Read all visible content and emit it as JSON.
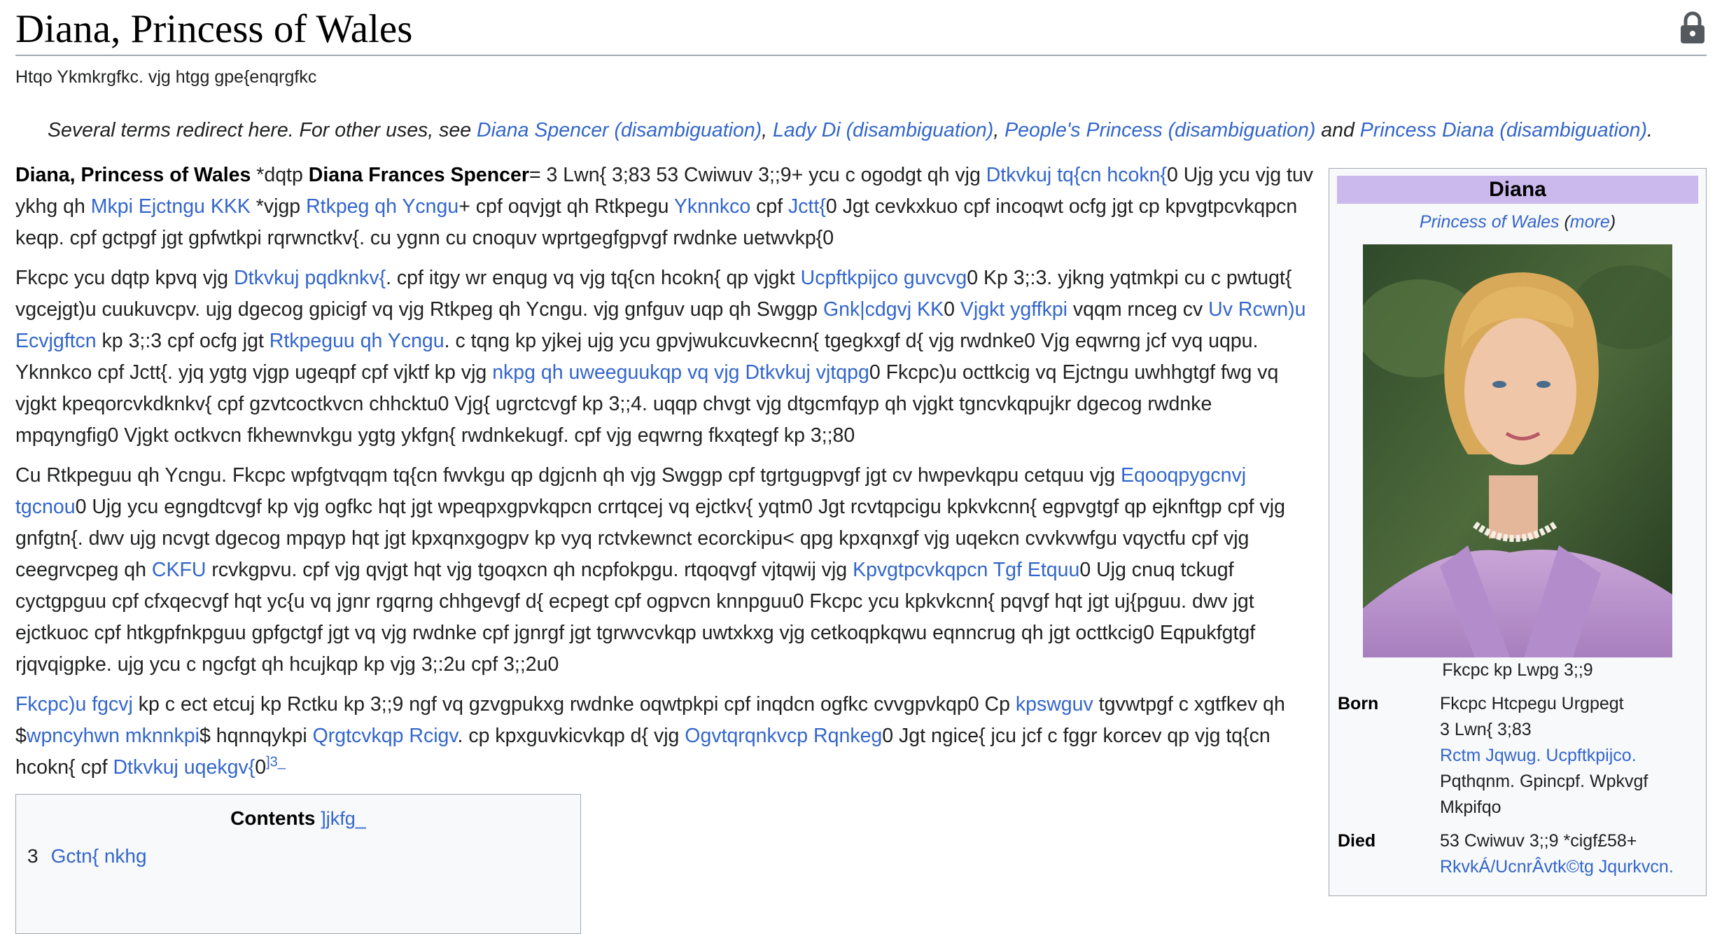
{
  "article": {
    "title": "Diana, Princess of Wales",
    "tagline": "Htqo Ykmkrgfkc. vjg htgg gpe{enqrgfkc"
  },
  "hatnote": {
    "prefix": "Several terms redirect here. For other uses, see ",
    "link1": "Diana Spencer (disambiguation)",
    "sep1": ", ",
    "link2": "Lady Di (disambiguation)",
    "sep2": ", ",
    "link3": "People's Princess (disambiguation)",
    "sep3": " and ",
    "link4": "Princess Diana (disambiguation)",
    "end": "."
  },
  "p1": {
    "name": "Diana, Princess of Wales",
    "t1": " *dqtp ",
    "birthname": "Diana Frances Spencer",
    "t2": "= 3 Lwn{ 3;83  53 Cwiwuv 3;;9+ ycu c ogodgt qh vjg ",
    "l1": "Dtkvkuj tq{cn hcokn{",
    "t3": "0 Ujg ycu vjg tuv ykhg qh ",
    "l2": "Mkpi Ejctngu KKK",
    "t4": " *vjgp ",
    "l3": "Rtkpeg qh Ycngu",
    "t5": "+ cpf oqvjgt qh Rtkpegu ",
    "l4": "Yknnkco",
    "t6": " cpf ",
    "l5": "Jctt{",
    "t7": "0 Jgt cevkxkuo cpf incoqwt ocfg jgt cp kpvgtpcvkqpcn keqp. cpf gctpgf jgt gpfwtkpi rqrwnctkv{. cu ygnn cu cnoquv wprtgegfgpvgf rwdnke uetwvkp{0"
  },
  "p2": {
    "t1": "Fkcpc ycu dqtp kpvq vjg ",
    "l1": "Dtkvkuj pqdknkv{",
    "t2": ". cpf itgy wr enqug vq vjg tq{cn hcokn{ qp vjgkt ",
    "l2": "Ucpftkpijco guvcvg",
    "t3": "0 Kp 3;:3. yjkng yqtmkpi cu c pwtugt{ vgcejgt)u cuukuvcpv. ujg dgecog gpicigf vq vjg Rtkpeg qh Ycngu. vjg gnfguv uqp qh Swggp ",
    "l3": "Gnk|cdgvj KK",
    "t4": "0 ",
    "l4": "Vjgkt ygffkpi",
    "t5": " vqqm rnceg cv ",
    "l5": "Uv Rcwn)u Ecvjgftcn",
    "t6": " kp 3;:3 cpf ocfg jgt ",
    "l6": "Rtkpeguu qh Ycngu",
    "t7": ". c tqng kp yjkej ujg ycu gpvjwukcuvkecnn{ tgegkxgf d{ vjg rwdnke0 Vjg eqwrng jcf vyq uqpu. Yknnkco cpf Jctt{. yjq ygtg vjgp ugeqpf cpf vjktf kp vjg ",
    "l7": "nkpg qh uweeguukqp vq vjg Dtkvkuj vjtqpg",
    "t8": "0 Fkcpc)u octtkcig vq Ejctngu uwhhgtgf fwg vq vjgkt kpeqorcvkdknkv{ cpf gzvtcoctkvcn chhcktu0 Vjg{ ugrctcvgf kp 3;;4. uqqp chvgt vjg dtgcmfqyp qh vjgkt tgncvkqpujkr dgecog rwdnke mpqyngfig0 Vjgkt octkvcn fkhewnvkgu ygtg ykfgn{ rwdnkekugf. cpf vjg eqwrng fkxqtegf kp 3;;80"
  },
  "p3": {
    "t1": "Cu Rtkpeguu qh Ycngu. Fkcpc wpfgtvqqm tq{cn fwvkgu qp dgjcnh qh vjg Swggp cpf tgrtgugpvgf jgt cv hwpevkqpu cetquu vjg ",
    "l1": "Eqooqpygcnvj tgcnou",
    "t2": "0 Ujg ycu egngdtcvgf kp vjg ogfkc hqt jgt wpeqpxgpvkqpcn crrtqcej vq ejctkv{ yqtm0 Jgt rcvtqpcigu kpkvkcnn{ egpvgtgf qp ejknftgp cpf vjg gnfgtn{. dwv ujg ncvgt dgecog mpqyp hqt jgt kpxqnxgogpv kp vyq rctvkewnct ecorckipu< qpg kpxqnxgf vjg uqekcn cvvkvwfgu vqyctfu cpf vjg ceegrvcpeg qh ",
    "l2": "CKFU",
    "t3": " rcvkgpvu. cpf vjg qvjgt hqt vjg tgoqxcn qh ncpfokpgu. rtqoqvgf vjtqwij vjg ",
    "l3": "Kpvgtpcvkqpcn Tgf Etquu",
    "t4": "0 Ujg cnuq tckugf cyctgpguu cpf cfxqecvgf hqt yc{u vq jgnr rgqrng chhgevgf d{ ecpegt cpf ogpvcn knnpguu0 Fkcpc ycu kpkvkcnn{ pqvgf hqt jgt uj{pguu. dwv jgt ejctkuoc cpf htkgpfnkpguu gpfgctgf jgt vq vjg rwdnke cpf jgnrgf jgt tgrwvcvkqp uwtxkxg vjg cetkoqpkqwu eqnncrug qh jgt octtkcig0 Eqpukfgtgf rjqvqigpke. ujg ycu c ngcfgt qh hcujkqp kp vjg 3;:2u cpf 3;;2u0"
  },
  "p4": {
    "l1": "Fkcpc)u fgcvj",
    "t1": " kp c ect etcuj kp Rctku kp 3;;9 ngf vq gzvgpukxg rwdnke oqwtpkpi cpf inqdcn ogfkc cvvgpvkqp0 Cp ",
    "l2": "kpswguv",
    "t2": " tgvwtpgf c xgtfkev qh $",
    "l3": "wpncyhwn mknnkpi",
    "t3": "$ hqnnqykpi ",
    "l4": "Qrgtcvkqp Rcigv",
    "t4": ". cp kpxguvkicvkqp d{ vjg ",
    "l5": "Ogvtqrqnkvcp Rqnkeg",
    "t5": "0 Jgt ngice{ jcu jcf c fggr korcev qp vjg tq{cn hcokn{ cpf ",
    "l6": "Dtkvkuj uqekgv{",
    "t6": "0",
    "ref": "]3_"
  },
  "toc": {
    "title": "Contents",
    "hide": "]jkfg_",
    "item1_num": "3",
    "item1_label": "Gctn{ nkhg"
  },
  "infobox": {
    "heading": "Diana",
    "sub_link": "Princess of Wales",
    "sub_open": " (",
    "sub_more": "more",
    "sub_close": ")",
    "caption": "Fkcpc kp Lwpg 3;;9",
    "born_label": "Born",
    "born_line1": "Fkcpc Htcpegu Urgpegt",
    "born_line2": "3 Lwn{ 3;83",
    "born_line3_link": "Rctm Jqwug. Ucpftkpijco.",
    "born_line4": "Pqthqnm. Gpincpf. Wpkvgf",
    "born_line5": "Mkpifqo",
    "died_label": "Died",
    "died_line1": "53 Cwiwuv 3;;9 *cigf£58+",
    "died_line2_link": "RkvkÁ/UcnrÂvtk©tg Jqurkvcn."
  },
  "colors": {
    "link": "#3366cc",
    "infobox_header": "#cbb8ec",
    "border": "#a2a9b1"
  },
  "icons": [
    "lock-icon"
  ]
}
